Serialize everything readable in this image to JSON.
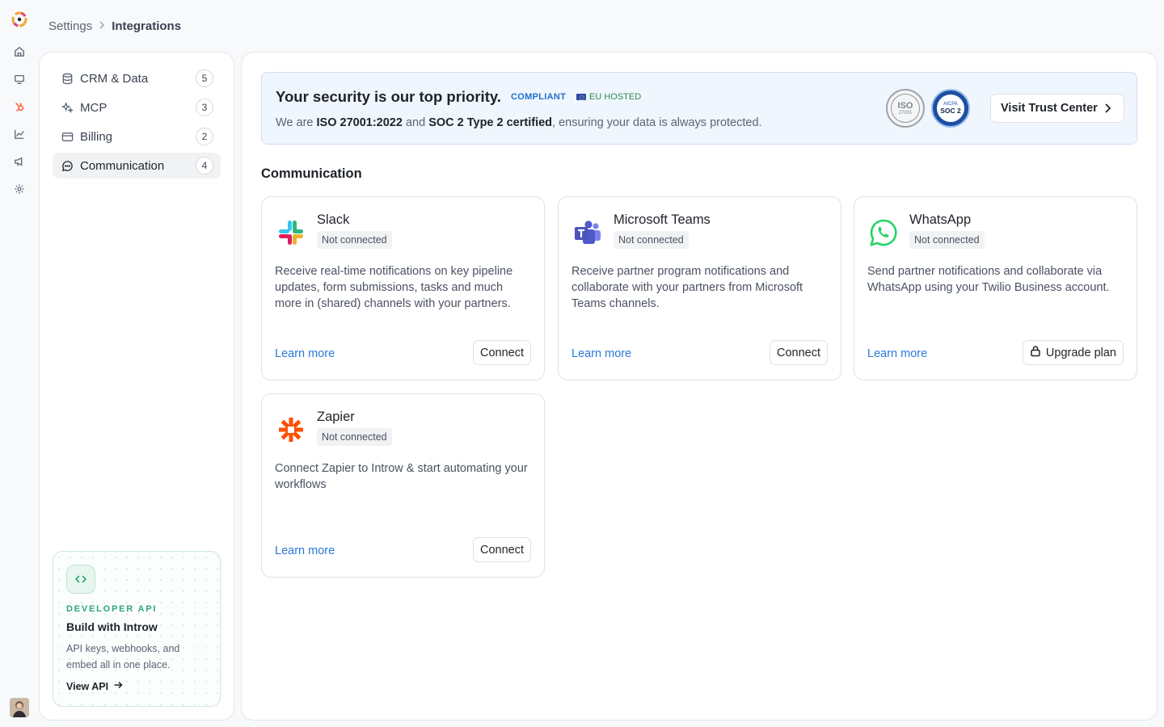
{
  "breadcrumb": {
    "parent": "Settings",
    "current": "Integrations"
  },
  "nav": {
    "items": [
      {
        "label": "CRM & Data",
        "count": "5",
        "icon": "database-icon"
      },
      {
        "label": "MCP",
        "count": "3",
        "icon": "sparkles-icon"
      },
      {
        "label": "Billing",
        "count": "2",
        "icon": "credit-card-icon"
      },
      {
        "label": "Communication",
        "count": "4",
        "icon": "chat-bubble-icon",
        "active": true
      }
    ]
  },
  "developer_card": {
    "eyebrow": "DEVELOPER API",
    "title": "Build with Introw",
    "description": "API keys, webhooks, and embed all in one place.",
    "link": "View API"
  },
  "security_banner": {
    "title": "Your security is our top priority.",
    "badge_compliant": "COMPLIANT",
    "badge_eu": "EU HOSTED",
    "desc_prefix": "We are ",
    "desc_iso": "ISO 27001:2022",
    "desc_and": " and ",
    "desc_soc": "SOC 2 Type 2 certified",
    "desc_suffix": ", ensuring your data is always protected.",
    "seal_iso": "ISO",
    "seal_iso_sub": "27001",
    "seal_soc_top": "AICPA",
    "seal_soc": "SOC 2",
    "button": "Visit Trust Center"
  },
  "section": {
    "title": "Communication"
  },
  "integrations": [
    {
      "name": "Slack",
      "status": "Not connected",
      "description": "Receive real-time notifications on key pipeline updates, form submissions, tasks and much more in (shared) channels with your partners.",
      "learn_more": "Learn more",
      "action": "Connect"
    },
    {
      "name": "Microsoft Teams",
      "status": "Not connected",
      "description": "Receive partner program notifications and collaborate with your partners from Microsoft Teams channels.",
      "learn_more": "Learn more",
      "action": "Connect"
    },
    {
      "name": "WhatsApp",
      "status": "Not connected",
      "description": "Send partner notifications and collaborate via WhatsApp using your Twilio Business account.",
      "learn_more": "Learn more",
      "action": "Upgrade plan"
    },
    {
      "name": "Zapier",
      "status": "Not connected",
      "description": "Connect Zapier to Introw & start automating your workflows",
      "learn_more": "Learn more",
      "action": "Connect"
    }
  ],
  "colors": {
    "accent": "#2a79d8",
    "green": "#2fa577",
    "slack": [
      "#e01e5a",
      "#36c5f0",
      "#2eb67d",
      "#ecb22e"
    ],
    "teams": "#5059c9",
    "whatsapp": "#25d366",
    "zapier": "#ff4f00"
  }
}
